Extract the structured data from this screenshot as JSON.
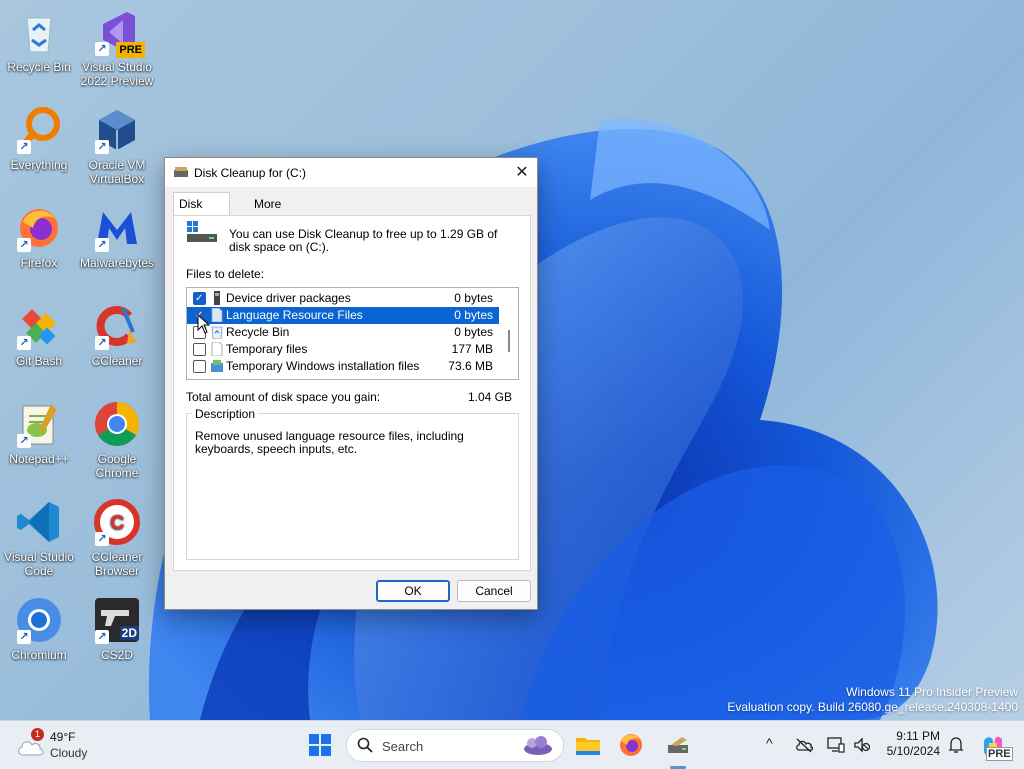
{
  "desktop": {
    "icons": [
      {
        "label": "Recycle Bin"
      },
      {
        "label": "Visual Studio 2022 Preview",
        "badge": "PRE"
      },
      {
        "label": "Everything"
      },
      {
        "label": "Oracle VM VirtualBox"
      },
      {
        "label": "Firefox"
      },
      {
        "label": "Malwarebytes"
      },
      {
        "label": "Git Bash"
      },
      {
        "label": "CCleaner"
      },
      {
        "label": "Notepad++"
      },
      {
        "label": "Google Chrome"
      },
      {
        "label": "Visual Studio Code"
      },
      {
        "label": "CCleaner Browser"
      },
      {
        "label": "Chromium"
      },
      {
        "label": "CS2D",
        "badge": "2D"
      }
    ]
  },
  "dialog": {
    "title": "Disk Cleanup for  (C:)",
    "close_glyph": "✕",
    "tabs": [
      "Disk Cleanup",
      "More Options"
    ],
    "intro": "You can use Disk Cleanup to free up to 1.29 GB of disk space on  (C:).",
    "files_to_delete_label": "Files to delete:",
    "files": [
      {
        "name": "Device driver packages",
        "size": "0 bytes",
        "checked": true,
        "icon": "driver-icon"
      },
      {
        "name": "Language Resource Files",
        "size": "0 bytes",
        "checked": true,
        "icon": "file-icon",
        "selected": true
      },
      {
        "name": "Recycle Bin",
        "size": "0 bytes",
        "checked": false,
        "icon": "recycle-bin-icon"
      },
      {
        "name": "Temporary files",
        "size": "177 MB",
        "checked": false,
        "icon": "file-icon"
      },
      {
        "name": "Temporary Windows installation files",
        "size": "73.6 MB",
        "checked": false,
        "icon": "setup-icon"
      }
    ],
    "total_label": "Total amount of disk space you gain:",
    "total_value": "1.04 GB",
    "description_legend": "Description",
    "description": "Remove unused language resource files, including keyboards, speech inputs, etc.",
    "ok_label": "OK",
    "cancel_label": "Cancel"
  },
  "watermark": {
    "line1": "Windows 11 Pro Insider Preview",
    "line2": "Evaluation copy. Build 26080.ge_release.240308-1400"
  },
  "taskbar": {
    "weather": {
      "badge": "1",
      "temp": "49°F",
      "condition": "Cloudy"
    },
    "search_placeholder": "Search",
    "time": "9:11 PM",
    "date": "5/10/2024",
    "copilot_badge": "PRE"
  },
  "colors": {
    "accent": "#0a64d2",
    "dialog_bg": "#f0f0f0",
    "taskbar_bg": "#e9eef4"
  }
}
